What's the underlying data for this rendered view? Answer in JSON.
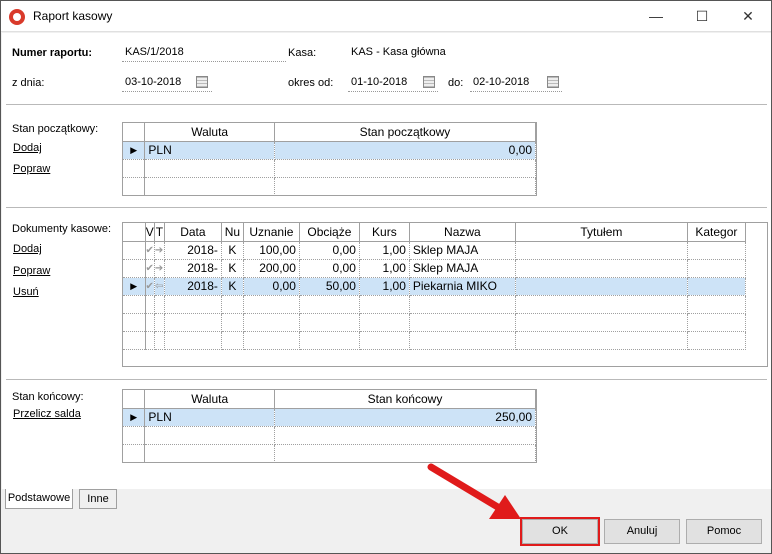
{
  "window": {
    "title": "Raport kasowy",
    "minimize_icon": "minimize-icon",
    "maximize_icon": "maximize-icon",
    "close_icon": "close-icon"
  },
  "header": {
    "numer_label": "Numer raportu:",
    "numer_value": "KAS/1/2018",
    "kasa_label": "Kasa:",
    "kasa_value": "KAS - Kasa główna",
    "z_dnia_label": "z dnia:",
    "z_dnia_value": "03-10-2018",
    "okres_od_label": "okres od:",
    "okres_od_value": "01-10-2018",
    "do_label": "do:",
    "do_value": "02-10-2018"
  },
  "stan_poczatkowy": {
    "label": "Stan początkowy:",
    "add": "Dodaj",
    "edit": "Popraw",
    "columns": [
      "Waluta",
      "Stan początkowy"
    ],
    "rows": [
      {
        "waluta": "PLN",
        "stan": "0,00"
      }
    ]
  },
  "dokumenty": {
    "label": "Dokumenty kasowe:",
    "add": "Dodaj",
    "edit": "Popraw",
    "delete": "Usuń",
    "columns": [
      "V",
      "T",
      "Data",
      "Nu",
      "Uznanie",
      "Obciąże",
      "Kurs",
      "Nazwa",
      "Tytułem",
      "Kategor"
    ],
    "rows": [
      {
        "data": "2018-",
        "nu": "K",
        "uznanie": "100,00",
        "obciazenie": "0,00",
        "kurs": "1,00",
        "nazwa": "Sklep MAJA",
        "tytulem": "",
        "kategoria": ""
      },
      {
        "data": "2018-",
        "nu": "K",
        "uznanie": "200,00",
        "obciazenie": "0,00",
        "kurs": "1,00",
        "nazwa": "Sklep MAJA",
        "tytulem": "",
        "kategoria": ""
      },
      {
        "data": "2018-",
        "nu": "K",
        "uznanie": "0,00",
        "obciazenie": "50,00",
        "kurs": "1,00",
        "nazwa": "Piekarnia MIKO",
        "tytulem": "",
        "kategoria": ""
      }
    ]
  },
  "stan_koncowy": {
    "label": "Stan końcowy:",
    "recalc": "Przelicz salda",
    "columns": [
      "Waluta",
      "Stan końcowy"
    ],
    "rows": [
      {
        "waluta": "PLN",
        "stan": "250,00"
      }
    ]
  },
  "tabs": [
    "Podstawowe",
    "Inne"
  ],
  "buttons": {
    "ok": "OK",
    "cancel": "Anuluj",
    "help": "Pomoc"
  },
  "colors": {
    "selection": "#cde3f7",
    "highlight": "#e01b1b"
  }
}
